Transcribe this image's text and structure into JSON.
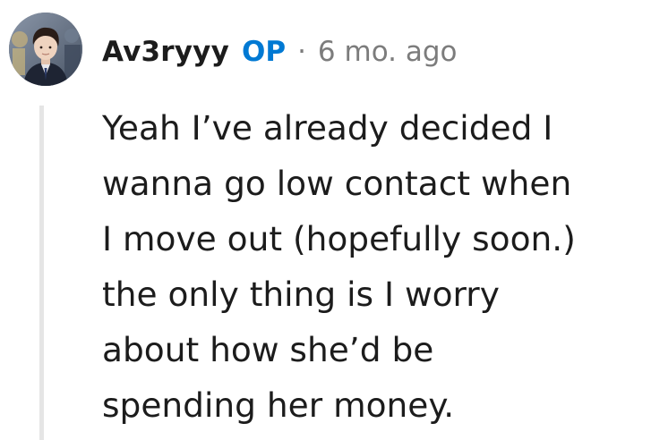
{
  "comment": {
    "username": "Av3ryyy",
    "op_badge": "OP",
    "separator": "·",
    "timestamp": "6 mo. ago",
    "body_lines": [
      "Yeah I’ve already decided I",
      "wanna go low contact when",
      "I move out (hopefully soon.)",
      "the only thing is I worry",
      "about how she’d be",
      "spending her money."
    ]
  },
  "colors": {
    "op_badge": "#0079d3",
    "meta_gray": "#7c7c7c",
    "text": "#1c1c1c",
    "thread_line": "#e5e5e5"
  }
}
